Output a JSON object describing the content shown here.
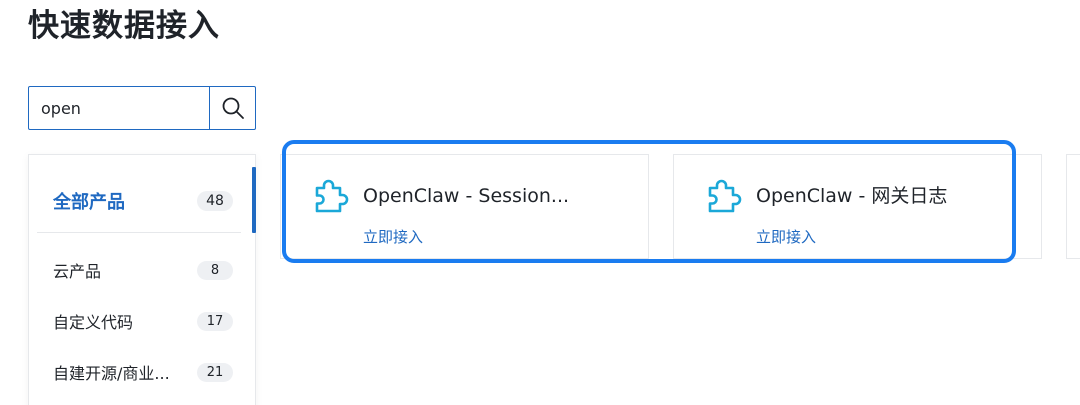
{
  "page": {
    "title": "快速数据接入"
  },
  "search": {
    "value": "open"
  },
  "sidebar": {
    "categories": [
      {
        "label": "全部产品",
        "count": "48"
      },
      {
        "label": "云产品",
        "count": "8"
      },
      {
        "label": "自定义代码",
        "count": "17"
      },
      {
        "label": "自建开源/商业...",
        "count": "21"
      }
    ]
  },
  "cards": [
    {
      "title": "OpenClaw - Session...",
      "action": "立即接入"
    },
    {
      "title": "OpenClaw - 网关日志",
      "action": "立即接入"
    }
  ],
  "colors": {
    "accent": "#1f69c1",
    "icon": "#1ba8d8",
    "highlight": "#1a7cf0"
  }
}
